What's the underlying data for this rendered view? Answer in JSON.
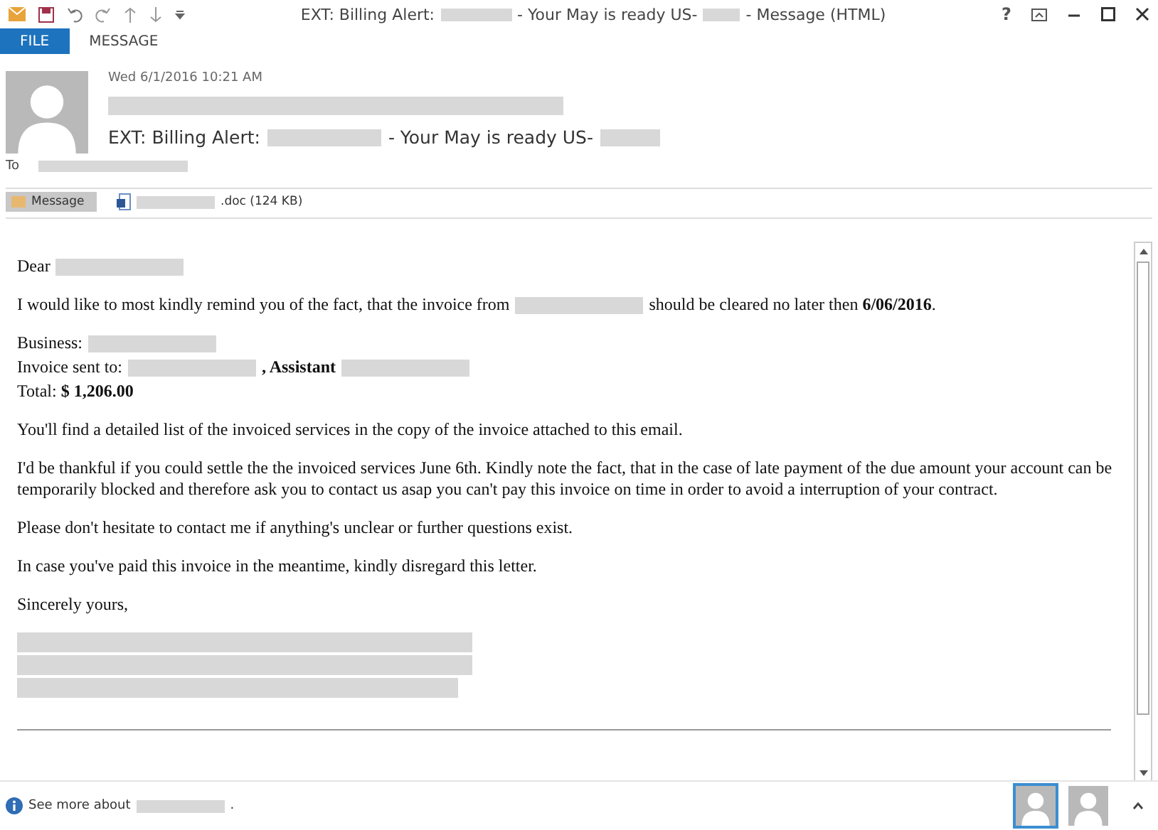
{
  "window": {
    "title_parts": [
      "EXT: Billing Alert:",
      "- Your May is ready US-",
      "- Message (HTML)"
    ],
    "help": "?"
  },
  "ribbon_tabs": [
    {
      "label": "FILE",
      "kind": "file"
    },
    {
      "label": "MESSAGE",
      "kind": "tab"
    }
  ],
  "header": {
    "date": "Wed 6/1/2016 10:21 AM",
    "subject_parts": [
      "EXT: Billing Alert:",
      "- Your May is ready US-"
    ],
    "to_label": "To"
  },
  "attachments": [
    {
      "label": "Message",
      "kind": "message",
      "selected": true
    },
    {
      "label": ".doc (124 KB)",
      "kind": "file",
      "selected": false
    }
  ],
  "body": [
    {
      "lines": [
        [
          {
            "kind": "text",
            "text": "Dear"
          },
          {
            "kind": "redacted"
          }
        ]
      ]
    },
    {
      "lines": [
        [
          {
            "kind": "text",
            "text": "I would like to most kindly remind you of the fact, that the invoice from"
          },
          {
            "kind": "redacted"
          },
          {
            "kind": "text",
            "text": "should be cleared no later then **6/06/2016**."
          }
        ]
      ]
    },
    {
      "lines": [
        [
          {
            "kind": "text",
            "text": "Business:"
          },
          {
            "kind": "redacted"
          }
        ],
        [
          {
            "kind": "text",
            "text": "Invoice sent to:"
          },
          {
            "kind": "redacted"
          },
          {
            "kind": "text",
            "text": "**, Assistant**"
          },
          {
            "kind": "redacted"
          }
        ],
        [
          {
            "kind": "text",
            "text": "Total: **$ 1,206.00**"
          }
        ]
      ]
    },
    {
      "lines": [
        [
          {
            "kind": "text",
            "text": "You'll find a detailed list of the invoiced services in the copy of the invoice attached to this email."
          }
        ]
      ]
    },
    {
      "lines": [
        [
          {
            "kind": "text",
            "text": "I'd be thankful if you could settle the the invoiced services June 6th. Kindly note the fact, that in the case of late payment of the due amount your account can be temporarily blocked and therefore ask you to contact us asap you can't pay this invoice on time in order to avoid a interruption of your contract."
          }
        ]
      ]
    },
    {
      "lines": [
        [
          {
            "kind": "text",
            "text": "Please don't hesitate to contact me if anything's unclear or further questions exist."
          }
        ]
      ]
    },
    {
      "lines": [
        [
          {
            "kind": "text",
            "text": "In case you've paid this invoice in the meantime, kindly disregard this letter."
          }
        ]
      ]
    },
    {
      "lines": [
        [
          {
            "kind": "text",
            "text": "Sincerely yours,"
          }
        ]
      ]
    }
  ],
  "footer": {
    "parts": [
      "See more about",
      "."
    ],
    "people": [
      {
        "selected": true
      },
      {
        "selected": false
      }
    ]
  }
}
